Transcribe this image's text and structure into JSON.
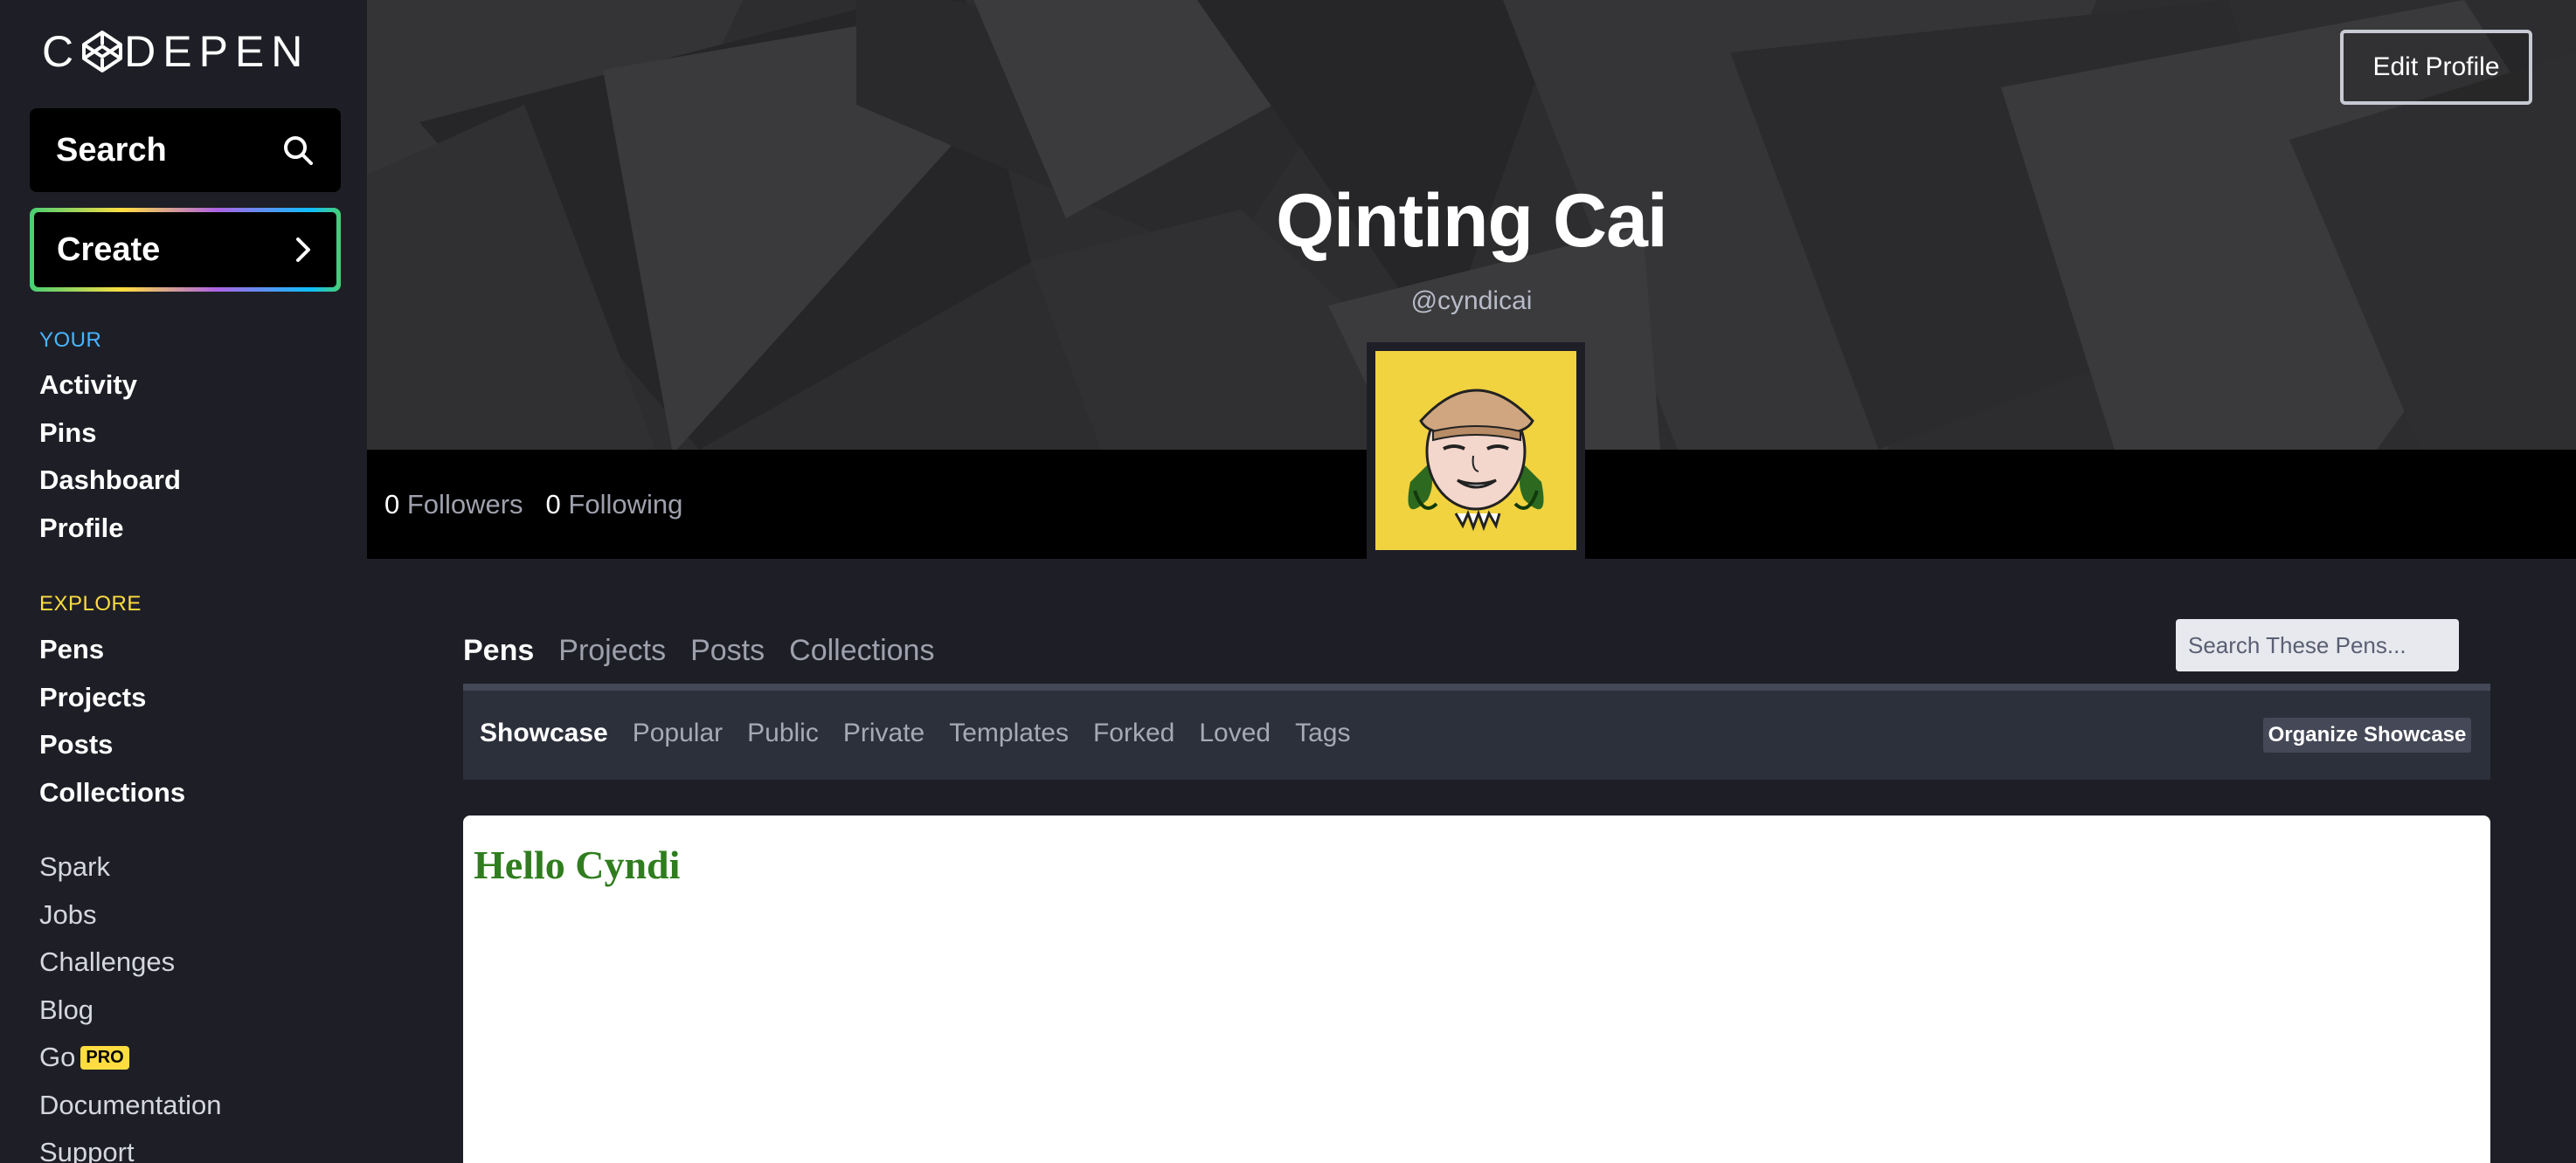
{
  "brand": {
    "logo_text": "CODEPEN"
  },
  "sidebar": {
    "search_label": "Search",
    "create_label": "Create",
    "your_heading": "YOUR",
    "your_items": [
      {
        "label": "Activity"
      },
      {
        "label": "Pins"
      },
      {
        "label": "Dashboard"
      },
      {
        "label": "Profile"
      }
    ],
    "explore_heading": "EXPLORE",
    "explore_items": [
      {
        "label": "Pens"
      },
      {
        "label": "Projects"
      },
      {
        "label": "Posts"
      },
      {
        "label": "Collections"
      }
    ],
    "other_items": [
      {
        "label": "Spark"
      },
      {
        "label": "Jobs"
      },
      {
        "label": "Challenges"
      },
      {
        "label": "Blog"
      },
      {
        "label": "Go",
        "badge": "PRO"
      },
      {
        "label": "Documentation"
      },
      {
        "label": "Support"
      }
    ]
  },
  "profile": {
    "name": "Qinting Cai",
    "handle": "@cyndicai",
    "edit_label": "Edit Profile",
    "followers_count": "0",
    "followers_label": "Followers",
    "following_count": "0",
    "following_label": "Following"
  },
  "tabs": {
    "items": [
      "Pens",
      "Projects",
      "Posts",
      "Collections"
    ],
    "active": "Pens",
    "search_placeholder": "Search These Pens..."
  },
  "subtabs": {
    "items": [
      "Showcase",
      "Popular",
      "Public",
      "Private",
      "Templates",
      "Forked",
      "Loved",
      "Tags"
    ],
    "active": "Showcase",
    "organize_label": "Organize Showcase"
  },
  "pen_preview": {
    "heading": "Hello Cyndi"
  },
  "colors": {
    "sidebar_bg": "#1e1f26",
    "your_heading": "#47b6ff",
    "explore_heading": "#ffdd40",
    "pro_badge": "#ffdd40",
    "avatar_bg": "#f1d23f",
    "pen_heading": "#2f7d1e"
  },
  "icons": {
    "search": "search-icon",
    "create": "chevron-right-icon",
    "logo": "codepen-logo-icon"
  }
}
